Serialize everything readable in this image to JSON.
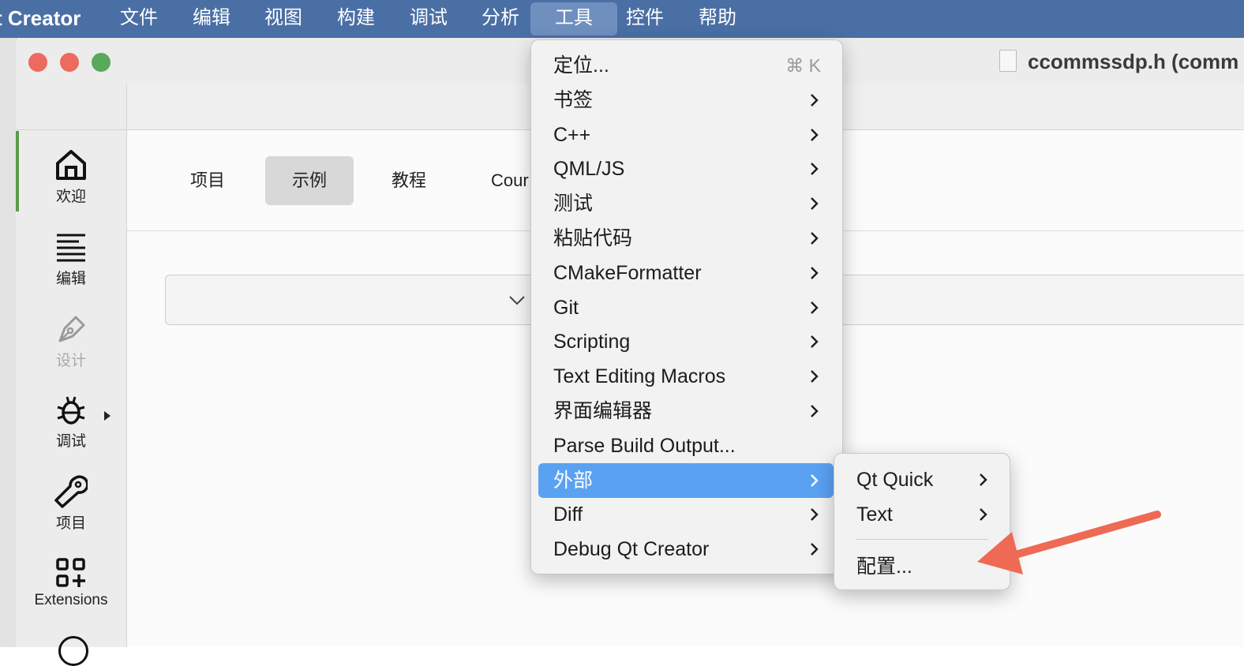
{
  "menubar": {
    "app_name": "t Creator",
    "items": [
      "文件",
      "编辑",
      "视图",
      "构建",
      "调试",
      "分析",
      "工具",
      "控件",
      "帮助"
    ],
    "active_item": "工具"
  },
  "window": {
    "file_title": "ccommssdp.h (comm"
  },
  "modebar": {
    "items": [
      {
        "label": "欢迎",
        "icon": "home-icon"
      },
      {
        "label": "编辑",
        "icon": "edit-lines-icon"
      },
      {
        "label": "设计",
        "icon": "pen-nib-icon"
      },
      {
        "label": "调试",
        "icon": "bug-icon"
      },
      {
        "label": "项目",
        "icon": "wrench-icon"
      },
      {
        "label": "Extensions",
        "icon": "extensions-icon"
      }
    ]
  },
  "welcome": {
    "tabs": [
      "项目",
      "示例",
      "教程",
      "Cour"
    ],
    "active_tab": "示例"
  },
  "tools_menu": {
    "items": [
      {
        "label": "定位...",
        "shortcut": "⌘ K"
      },
      {
        "label": "书签"
      },
      {
        "label": "C++"
      },
      {
        "label": "QML/JS"
      },
      {
        "label": "测试"
      },
      {
        "label": "粘贴代码"
      },
      {
        "label": "CMakeFormatter"
      },
      {
        "label": "Git"
      },
      {
        "label": "Scripting"
      },
      {
        "label": "Text Editing Macros"
      },
      {
        "label": "界面编辑器"
      },
      {
        "label": "Parse Build Output..."
      },
      {
        "label": "外部"
      },
      {
        "label": "Diff"
      },
      {
        "label": "Debug Qt Creator"
      }
    ],
    "highlighted": "外部"
  },
  "external_submenu": {
    "items": [
      {
        "label": "Qt Quick"
      },
      {
        "label": "Text"
      },
      {
        "label": "配置..."
      }
    ]
  },
  "colors": {
    "menubar": "#4a6fa5",
    "highlight": "#5aa1f2",
    "annotation_arrow": "#ee6a55",
    "active_mode_strip": "#5b9b4c"
  }
}
